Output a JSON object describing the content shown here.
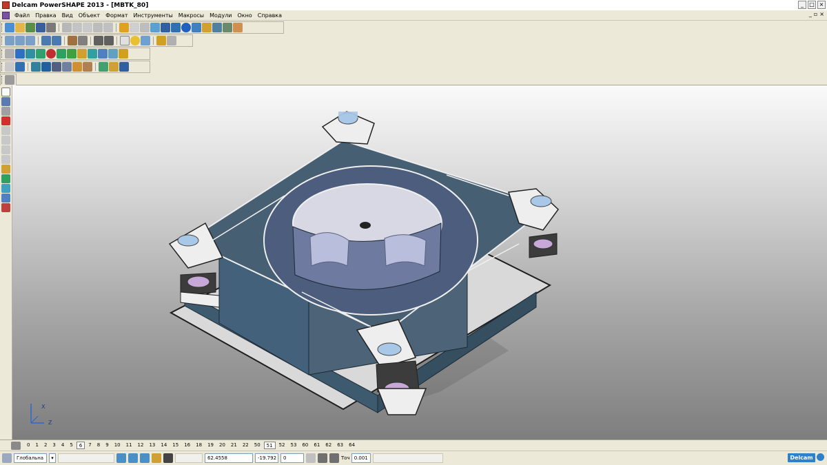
{
  "window": {
    "title": "Delcam PowerSHAPE 2013 - [MBTK_80]"
  },
  "menu": [
    "Файл",
    "Правка",
    "Вид",
    "Объект",
    "Формат",
    "Инструменты",
    "Макросы",
    "Модули",
    "Окно",
    "Справка"
  ],
  "window_buttons": {
    "minimize": "_",
    "maximize": "□",
    "close": "×"
  },
  "mdi_buttons": {
    "minimize": "_",
    "restore": "▫",
    "close": "×"
  },
  "levels": {
    "items": [
      "0",
      "1",
      "2",
      "3",
      "4",
      "5",
      "6",
      "7",
      "8",
      "9",
      "10",
      "11",
      "12",
      "13",
      "14",
      "15",
      "16",
      "18",
      "19",
      "20",
      "21",
      "22",
      "50",
      "51",
      "52",
      "53",
      "60",
      "61",
      "62",
      "63",
      "64"
    ],
    "active": [
      "6",
      "51"
    ]
  },
  "status": {
    "workplane": "Глобальна",
    "coord_x": "62.4558",
    "coord_y": "-19.792",
    "coord_z": "0",
    "tolerance_label": "Точ",
    "tolerance_value": "0.001"
  },
  "brand": "Delcam",
  "axis": {
    "x": "X",
    "z": "Z"
  },
  "colors": {
    "accent": "#2f7fc9",
    "model_panel": "#3e5a6e",
    "model_ring": "#4c5d7e",
    "model_plate": "#eeeeee",
    "model_pad": "#a9c7e6"
  }
}
